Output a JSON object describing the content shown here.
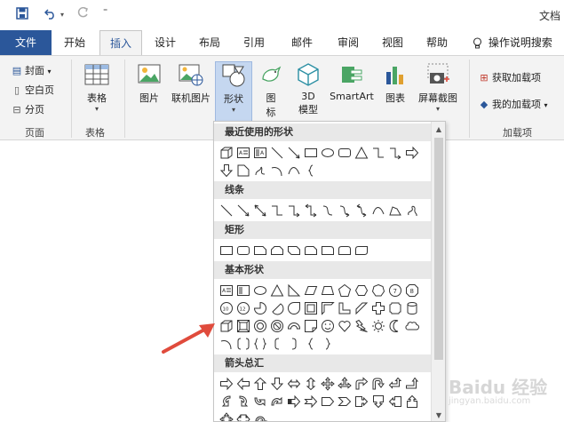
{
  "title_bar": {
    "doc_title": "文档"
  },
  "tabs": [
    {
      "label": "文件",
      "key": "file"
    },
    {
      "label": "开始",
      "key": "home"
    },
    {
      "label": "插入",
      "key": "insert",
      "active": true
    },
    {
      "label": "设计",
      "key": "design"
    },
    {
      "label": "布局",
      "key": "layout"
    },
    {
      "label": "引用",
      "key": "refs"
    },
    {
      "label": "邮件",
      "key": "mail"
    },
    {
      "label": "审阅",
      "key": "review"
    },
    {
      "label": "视图",
      "key": "view"
    },
    {
      "label": "帮助",
      "key": "help"
    }
  ],
  "tell_me": "操作说明搜索",
  "ribbon": {
    "pages_group": {
      "cover": "封面",
      "blank": "空白页",
      "break": "分页",
      "label": "页面"
    },
    "table_group": {
      "table": "表格",
      "label": "表格"
    },
    "illustrations": {
      "picture": "图片",
      "online_picture": "联机图片",
      "shapes": "形状",
      "icons_l1": "图",
      "icons_l2": "标",
      "model_l1": "3D",
      "model_l2": "模型",
      "smartart": "SmartArt",
      "chart": "图表",
      "screenshot": "屏幕截图"
    },
    "addins": {
      "get": "获取加载项",
      "mine": "我的加载项",
      "label": "加载项"
    }
  },
  "shapes_panel": {
    "sections": {
      "recent": "最近使用的形状",
      "lines": "线条",
      "rects": "矩形",
      "basic": "基本形状",
      "arrows": "箭头总汇"
    }
  },
  "watermark": {
    "main": "Baidu 经验",
    "sub": "jingyan.baidu.com"
  },
  "colors": {
    "accent": "#2b579a",
    "selected": "#c5d7f0",
    "arrow": "#e04b3c"
  }
}
